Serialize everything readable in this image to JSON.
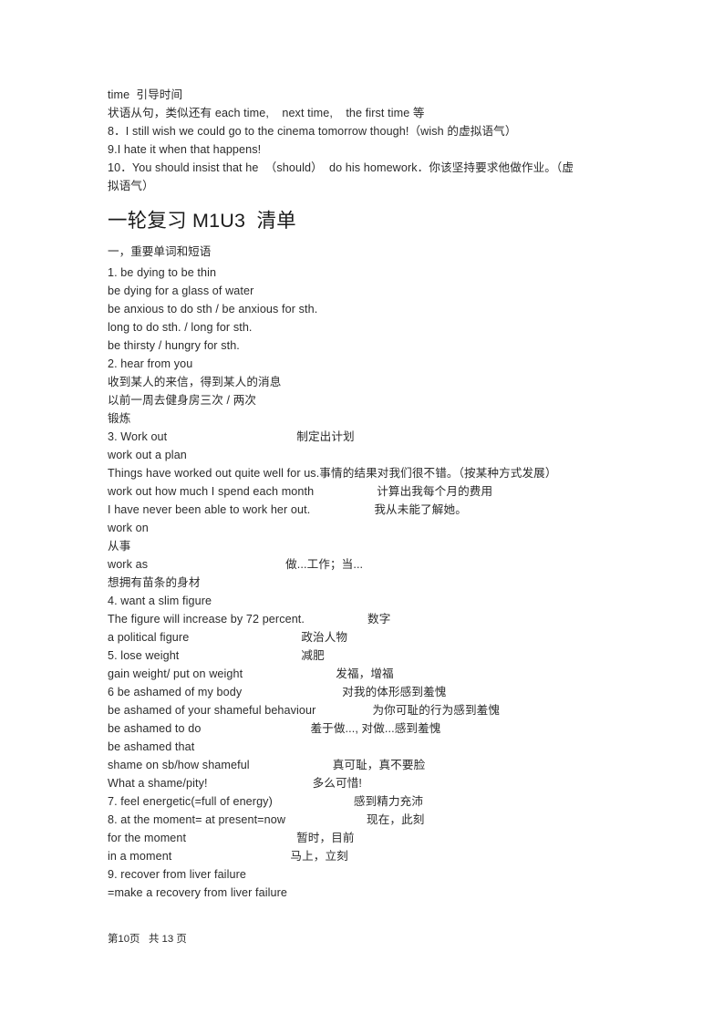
{
  "document": {
    "title": "一轮复习 M1U3  清单",
    "section_label": "一，重要单词和短语",
    "footer": "第10页   共 13 页"
  },
  "intro_lines": [
    "time  引导时间",
    "状语从句，类似还有 each time,    next time,    the first time 等",
    "8．I still wish we could go to the cinema tomorrow though!（wish 的虚拟语气）",
    "9.I hate it when that happens!",
    "10．You should insist that he  （should）  do his homework．你该坚持要求他做作业。（虚",
    "拟语气）"
  ],
  "entries": [
    {
      "en": "1. be dying to be thin",
      "zh": "",
      "indent": 0
    },
    {
      "en": "be dying for a glass of water",
      "zh": "",
      "indent": 0
    },
    {
      "en": "be anxious to do sth / be anxious for sth.",
      "zh": "",
      "indent": 0
    },
    {
      "en": "long to do sth. / long for sth.",
      "zh": "",
      "indent": 0
    },
    {
      "en": "be thirsty / hungry for sth.",
      "zh": "",
      "indent": 0
    },
    {
      "en": "2. hear from you",
      "zh": "",
      "indent": 0
    },
    {
      "en": "收到某人的来信，得到某人的消息",
      "zh": "",
      "indent": 0
    },
    {
      "en": "以前一周去健身房三次 / 两次",
      "zh": "",
      "indent": 0
    },
    {
      "en": "锻炼",
      "zh": "",
      "indent": 0
    },
    {
      "en": "3. Work out",
      "zh": "制定出计划",
      "indent": 207
    },
    {
      "en": "work out a plan",
      "zh": "",
      "indent": 0
    },
    {
      "en": "Things have worked out quite well for us.事情的结果对我们很不错。（按某种方式发展）",
      "zh": "",
      "indent": 0
    },
    {
      "en": "work out how much I spend each month",
      "zh": "计算出我每个月的费用",
      "indent": 295
    },
    {
      "en": "I have never been able to work her out.",
      "zh": "我从未能了解她。",
      "indent": 292
    },
    {
      "en": "work on",
      "zh": "",
      "indent": 0
    },
    {
      "en": "从事",
      "zh": "",
      "indent": 0
    },
    {
      "en": "work as",
      "zh": "做...工作；当...",
      "indent": 195
    },
    {
      "en": "想拥有苗条的身材",
      "zh": "",
      "indent": 0
    },
    {
      "en": "4. want a slim figure",
      "zh": "",
      "indent": 0
    },
    {
      "en": "The figure will increase by 72 percent.",
      "zh": "数字",
      "indent": 285
    },
    {
      "en": "a political figure",
      "zh": "政治人物",
      "indent": 212
    },
    {
      "en": "5. lose weight",
      "zh": "减肥",
      "indent": 212
    },
    {
      "en": "gain weight/ put on weight",
      "zh": "发福，增福",
      "indent": 250
    },
    {
      "en": "6 be ashamed of my body",
      "zh": "对我的体形感到羞愧",
      "indent": 257
    },
    {
      "en": "be ashamed of your shameful behaviour",
      "zh": "为你可耻的行为感到羞愧",
      "indent": 290
    },
    {
      "en": "be ashamed to do",
      "zh": "羞于做..., 对做...感到羞愧",
      "indent": 222
    },
    {
      "en": "be ashamed that",
      "zh": "",
      "indent": 0
    },
    {
      "en": "shame on sb/how shameful",
      "zh": "真可耻，真不要脸",
      "indent": 247
    },
    {
      "en": "What a shame/pity!",
      "zh": "多么可惜!",
      "indent": 225
    },
    {
      "en": "7. feel energetic(=full of energy)",
      "zh": "感到精力充沛",
      "indent": 270
    },
    {
      "en": "8. at the moment= at present=now",
      "zh": "现在，此刻",
      "indent": 284
    },
    {
      "en": "for the moment",
      "zh": "暂时，目前",
      "indent": 207
    },
    {
      "en": "in a moment",
      "zh": "马上，立刻",
      "indent": 200
    },
    {
      "en": "9. recover from liver failure",
      "zh": "",
      "indent": 0
    },
    {
      "en": "=make a recovery from liver failure",
      "zh": "",
      "indent": 0
    }
  ]
}
